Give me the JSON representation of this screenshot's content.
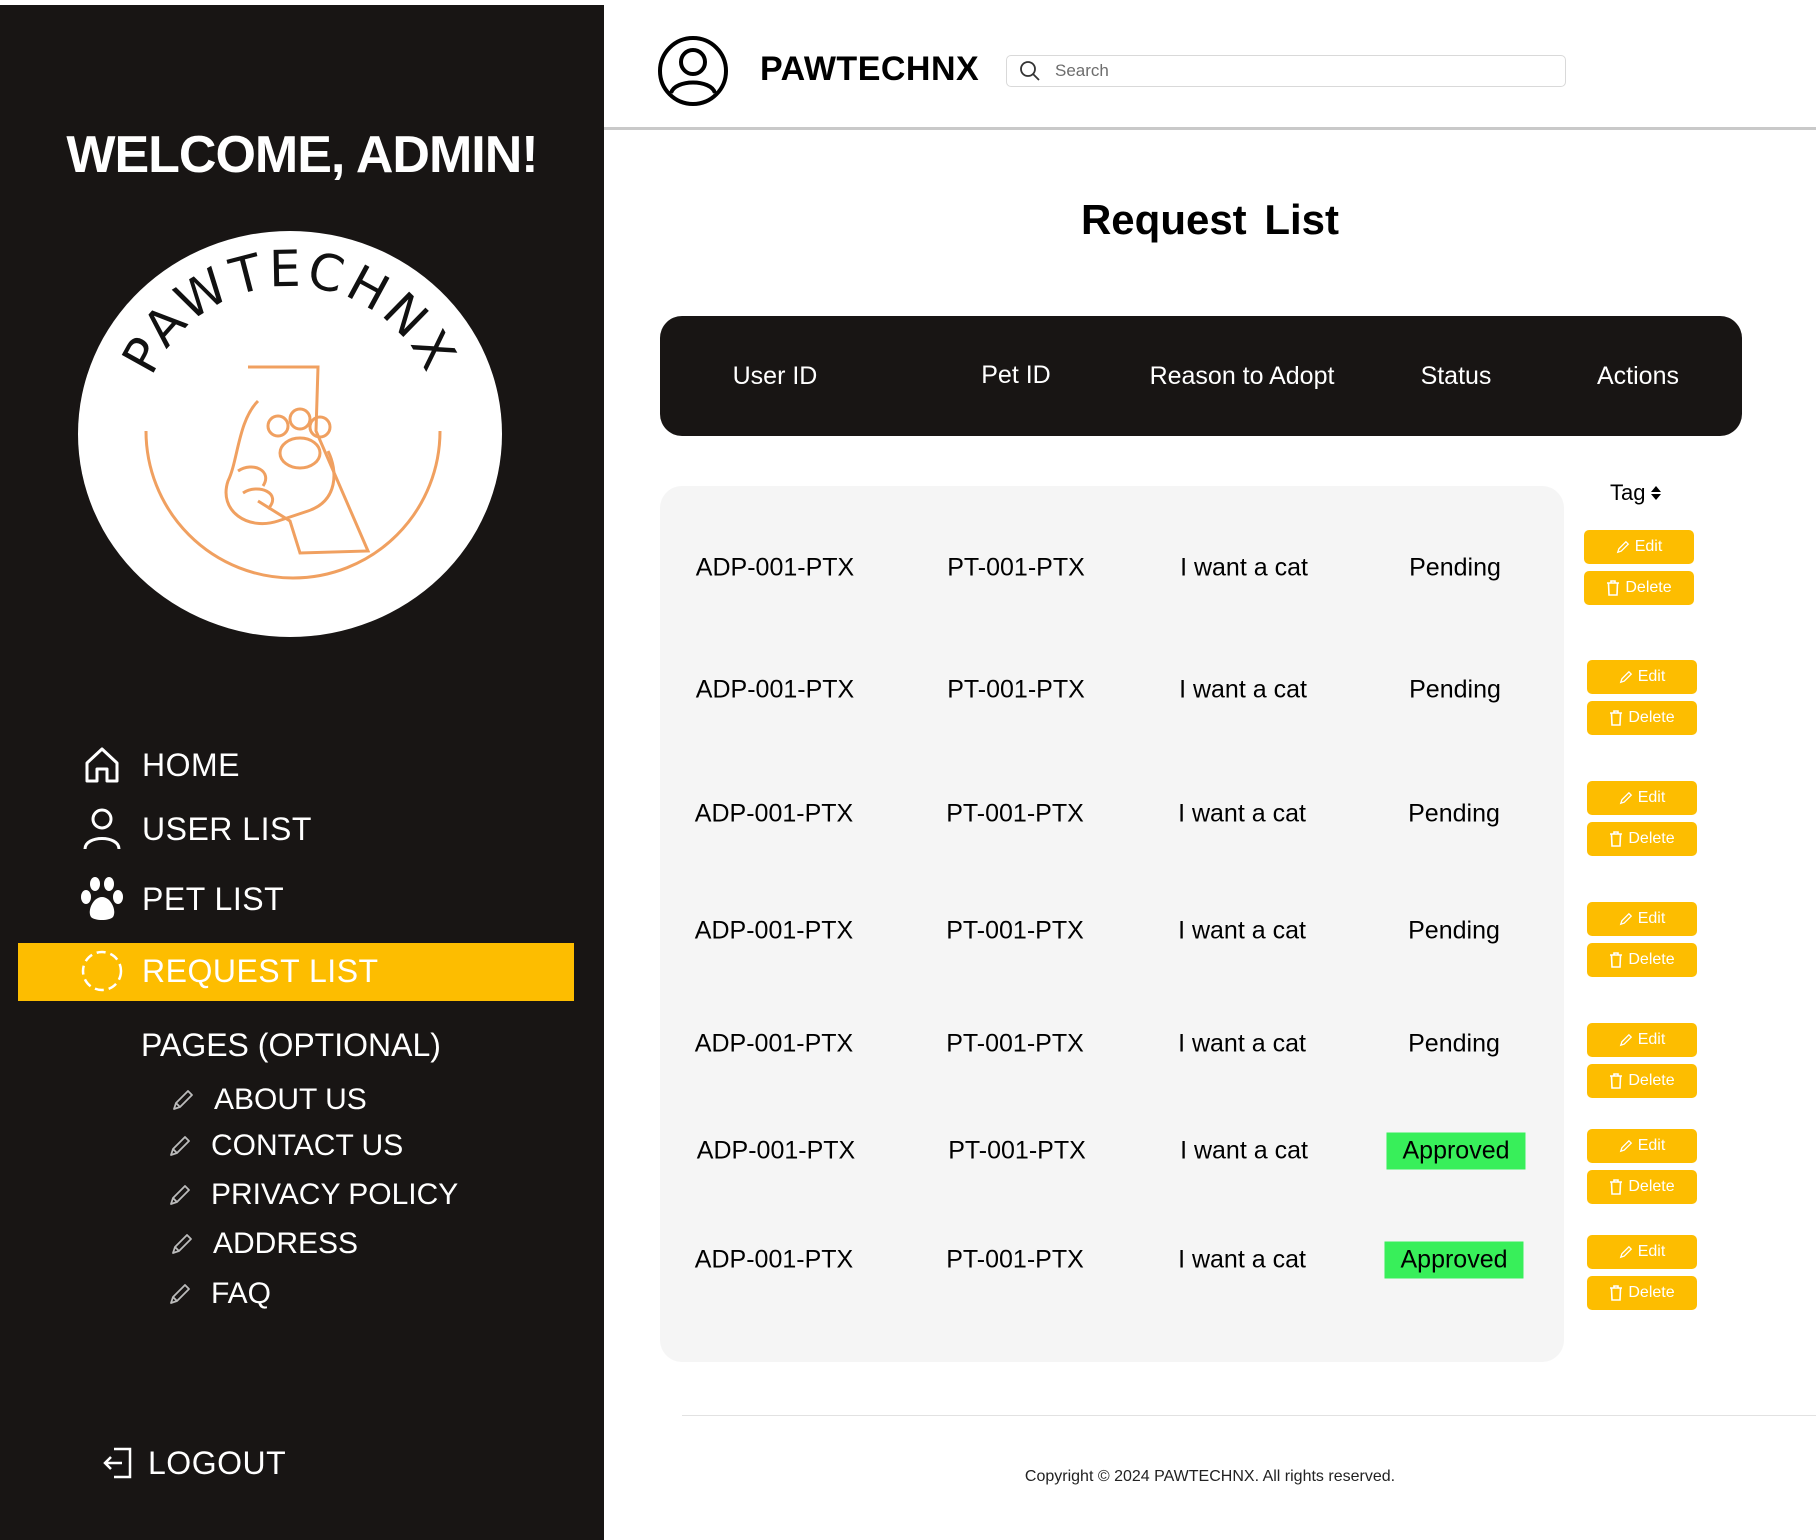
{
  "sidebar": {
    "welcome": "WELCOME, ADMIN!",
    "logo_text": "PAWTECHNX",
    "nav": [
      {
        "label": "HOME",
        "icon": "home-icon"
      },
      {
        "label": "USER LIST",
        "icon": "user-icon"
      },
      {
        "label": "PET LIST",
        "icon": "paw-icon"
      },
      {
        "label": "REQUEST LIST",
        "icon": "loading-circle-icon",
        "active": true
      }
    ],
    "pages_title": "PAGES (OPTIONAL)",
    "pages": [
      {
        "label": "ABOUT US",
        "icon": "pencil-icon"
      },
      {
        "label": "CONTACT US",
        "icon": "pencil-icon"
      },
      {
        "label": "PRIVACY POLICY",
        "icon": "pencil-icon"
      },
      {
        "label": "ADDRESS",
        "icon": "pencil-icon"
      },
      {
        "label": "FAQ",
        "icon": "pencil-icon"
      }
    ],
    "logout": "LOGOUT",
    "active_color": "#FDBD00",
    "background": "#181514"
  },
  "header": {
    "brand": "PAWTECHNX",
    "search_placeholder": "Search"
  },
  "main": {
    "title": "Request List",
    "columns": [
      "User ID",
      "Pet ID",
      "Reason to Adopt",
      "Status",
      "Actions"
    ],
    "tag_label": "Tag",
    "edit_label": "Edit",
    "delete_label": "Delete",
    "rows": [
      {
        "user_id": "ADP-001-PTX",
        "pet_id": "PT-001-PTX",
        "reason": "I want a cat",
        "status": "Pending"
      },
      {
        "user_id": "ADP-001-PTX",
        "pet_id": "PT-001-PTX",
        "reason": "I want a cat",
        "status": "Pending"
      },
      {
        "user_id": "ADP-001-PTX",
        "pet_id": "PT-001-PTX",
        "reason": "I want a cat",
        "status": "Pending"
      },
      {
        "user_id": "ADP-001-PTX",
        "pet_id": "PT-001-PTX",
        "reason": "I want a cat",
        "status": "Pending"
      },
      {
        "user_id": "ADP-001-PTX",
        "pet_id": "PT-001-PTX",
        "reason": "I want a cat",
        "status": "Pending"
      },
      {
        "user_id": "ADP-001-PTX",
        "pet_id": "PT-001-PTX",
        "reason": "I want a cat",
        "status": "Approved"
      },
      {
        "user_id": "ADP-001-PTX",
        "pet_id": "PT-001-PTX",
        "reason": "I want a cat",
        "status": "Approved"
      }
    ],
    "approved_color": "#38EF5A",
    "button_color": "#FDBD00"
  },
  "footer": {
    "copyright": "Copyright © 2024 PAWTECHNX. All rights reserved."
  }
}
